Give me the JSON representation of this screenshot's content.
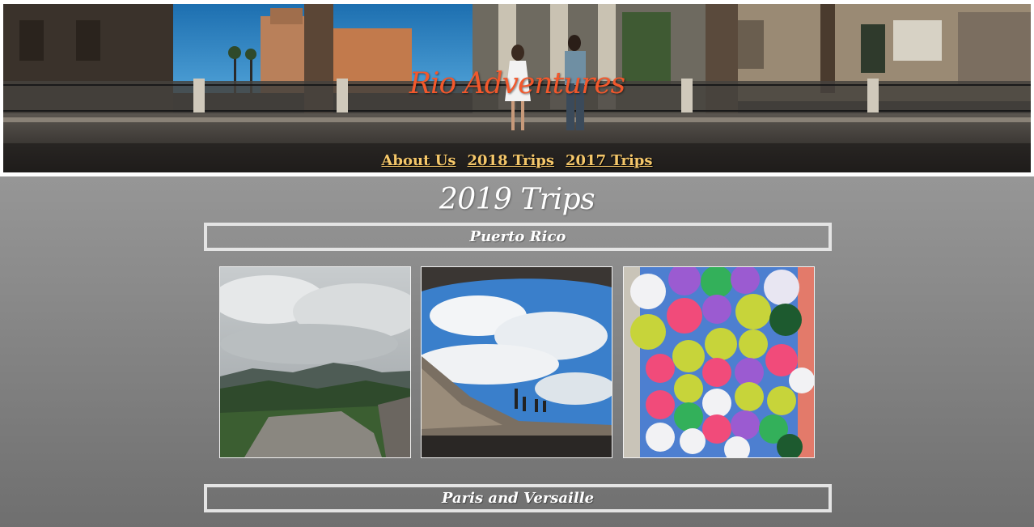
{
  "header": {
    "site_title": "Rio Adventures",
    "nav": [
      {
        "label": "About Us"
      },
      {
        "label": "2018 Trips"
      },
      {
        "label": "2017 Trips"
      }
    ],
    "accent_color": "#f2582c",
    "nav_color": "#f5c76a"
  },
  "main": {
    "page_title": "2019 Trips",
    "trips": [
      {
        "name": "Puerto Rico",
        "photos": [
          {
            "subject": "cloudy mountain rainforest view"
          },
          {
            "subject": "fort window view of blue sky"
          },
          {
            "subject": "colorful umbrellas overhead"
          }
        ]
      },
      {
        "name": "Paris and Versaille"
      }
    ]
  }
}
